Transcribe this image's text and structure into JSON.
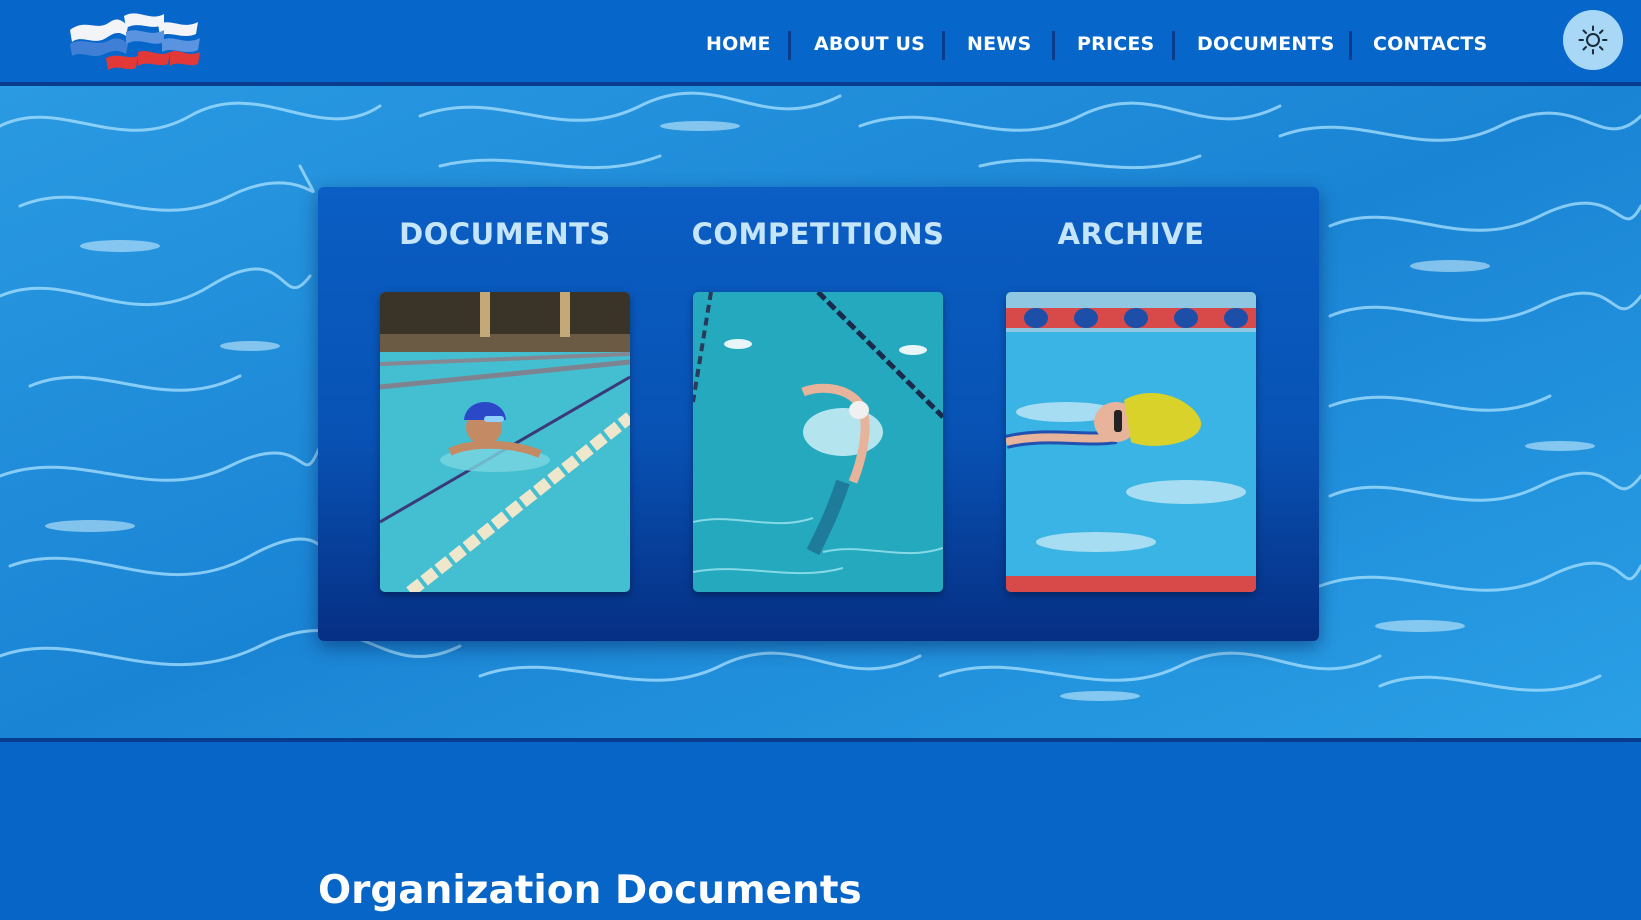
{
  "header": {
    "logo": "flag-waves-logo",
    "nav": [
      {
        "label": "HOME"
      },
      {
        "label": "ABOUT US"
      },
      {
        "label": "NEWS"
      },
      {
        "label": "PRICES"
      },
      {
        "label": "DOCUMENTS"
      },
      {
        "label": "CONTACTS"
      }
    ],
    "theme_toggle_icon": "sun-icon"
  },
  "hero": {
    "background": "pool-water",
    "cards": [
      {
        "title": "DOCUMENTS",
        "image": "swimmer-purple-cap-lane"
      },
      {
        "title": "COMPETITIONS",
        "image": "freestyle-swimmer-lanes"
      },
      {
        "title": "ARCHIVE",
        "image": "swimmer-yellow-cap"
      }
    ]
  },
  "section": {
    "title": "Organization Documents"
  },
  "colors": {
    "header_bg": "#0766c9",
    "accent_dark": "#083c8e",
    "card_title": "#c5e5fb",
    "theme_button": "#a9d8f6"
  }
}
